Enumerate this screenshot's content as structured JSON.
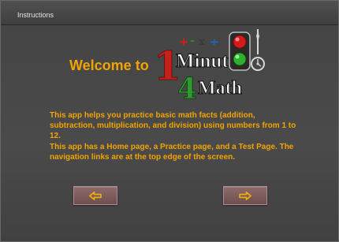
{
  "window": {
    "title": "Instructions"
  },
  "welcome": {
    "text": "Welcome to"
  },
  "logo": {
    "number": "1",
    "word_top": "Minute",
    "number_bottom": "4",
    "word_bottom": "Math",
    "operators": [
      "+",
      "-",
      "x",
      "÷"
    ]
  },
  "content": {
    "paragraph1": "This app helps you practice basic math facts (addition, subtraction, multiplication, and division) using numbers from 1 to 12.",
    "paragraph2": "This app has a Home page, a Practice page, and a Test Page. The navigation links are at the top edge of the screen."
  },
  "navigation": {
    "back_icon": "arrow-left-icon",
    "next_icon": "arrow-right-icon"
  },
  "colors": {
    "accent_text": "#f2a400",
    "background": "#4a4a4a",
    "button": "#7d5c5c",
    "logo_red": "#c8201a",
    "logo_green": "#2f9a2f"
  }
}
